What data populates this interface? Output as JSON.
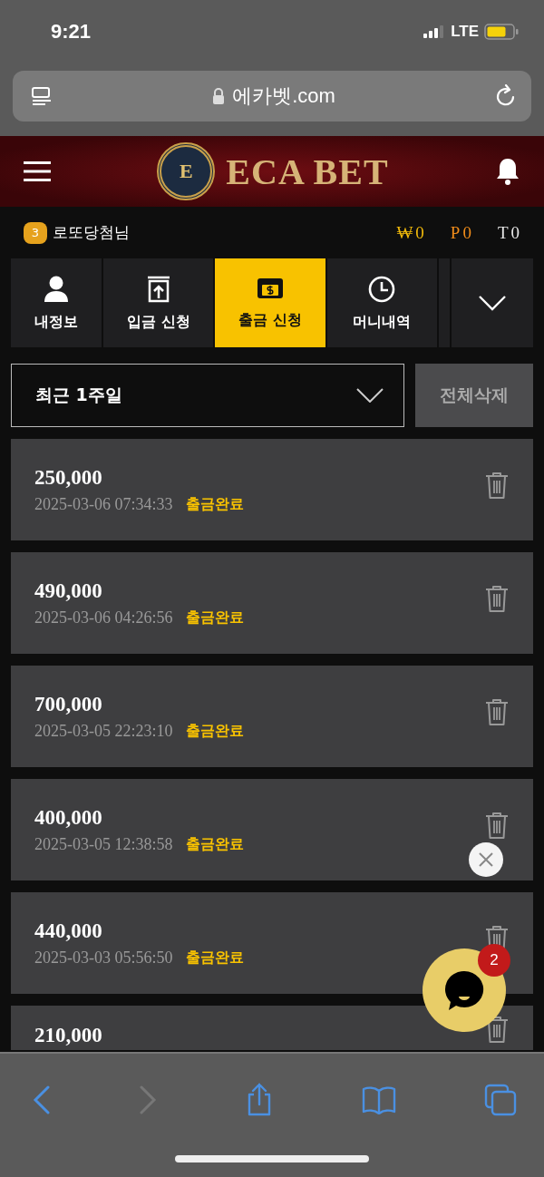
{
  "status_bar": {
    "time": "9:21",
    "network": "LTE"
  },
  "browser": {
    "url": "에카벳.com"
  },
  "header": {
    "logo_mark": "E",
    "brand": "ECA BET"
  },
  "user": {
    "level": "3",
    "name": "로또당첨님",
    "balances": [
      {
        "label": "₩0",
        "color": "#f0b90b"
      },
      {
        "label": "P0",
        "color": "#f08c1a"
      },
      {
        "label": "T0",
        "color": "#e6e6e6"
      }
    ]
  },
  "tabs": [
    {
      "label": "내정보",
      "kind": "person",
      "selected": false
    },
    {
      "label": "입금 신청",
      "kind": "deposit",
      "selected": false
    },
    {
      "label": "출금 신청",
      "kind": "withdraw",
      "selected": true
    },
    {
      "label": "머니내역",
      "kind": "history",
      "selected": false
    }
  ],
  "filter": {
    "period": "최근 1주일",
    "delete_all": "전체삭제"
  },
  "rows": [
    {
      "amount": "250,000",
      "datetime": "2025-03-06 07:34:33",
      "status": "출금완료"
    },
    {
      "amount": "490,000",
      "datetime": "2025-03-06 04:26:56",
      "status": "출금완료"
    },
    {
      "amount": "700,000",
      "datetime": "2025-03-05 22:23:10",
      "status": "출금완료"
    },
    {
      "amount": "400,000",
      "datetime": "2025-03-05 12:38:58",
      "status": "출금완료"
    },
    {
      "amount": "440,000",
      "datetime": "2025-03-03 05:56:50",
      "status": "출금완료"
    },
    {
      "amount": "210,000"
    }
  ],
  "chat": {
    "badge": "2"
  }
}
